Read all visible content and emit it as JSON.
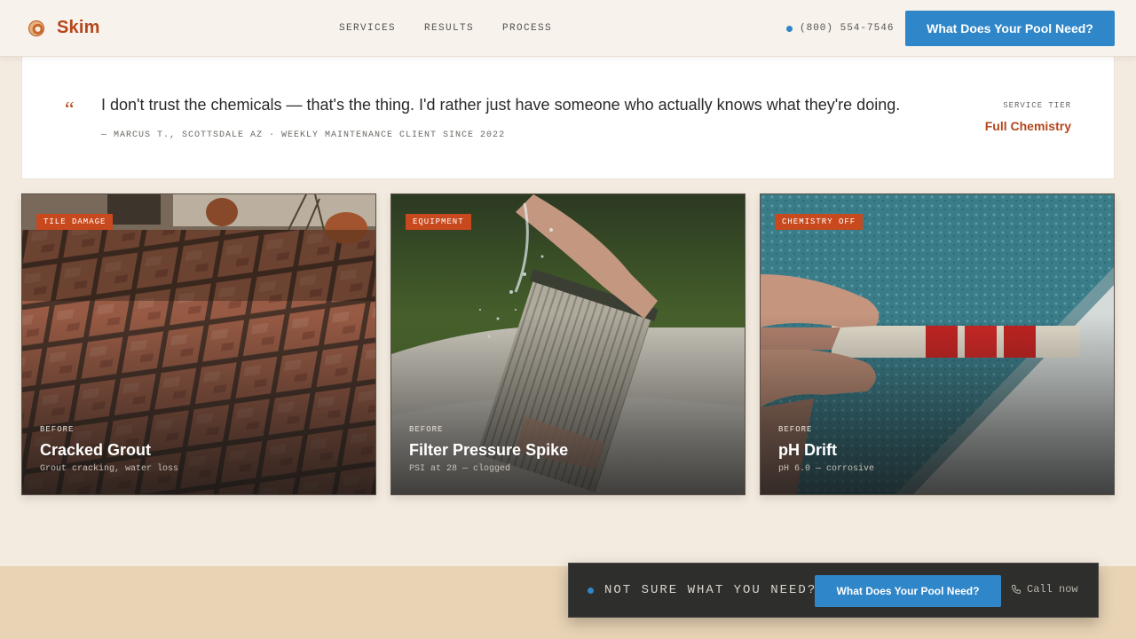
{
  "header": {
    "logo_text": "Skim",
    "nav": [
      "SERVICES",
      "RESULTS",
      "PROCESS"
    ],
    "phone": "(800) 554-7546",
    "cta_label": "What Does Your Pool Need?"
  },
  "testimonial": {
    "quote_mark": "“",
    "quote": "I don't trust the chemicals — that's the thing. I'd rather just have someone who actually knows what they're doing.",
    "attribution": "— MARCUS T., SCOTTSDALE AZ · WEEKLY MAINTENANCE CLIENT SINCE 2022",
    "tier_label": "SERVICE TIER",
    "tier_value": "Full Chemistry"
  },
  "cards": [
    {
      "badge": "TILE DAMAGE",
      "meta": "BEFORE",
      "title": "Cracked Grout",
      "subtitle": "Grout cracking, water loss"
    },
    {
      "badge": "EQUIPMENT",
      "meta": "BEFORE",
      "title": "Filter Pressure Spike",
      "subtitle": "PSI at 28 — clogged"
    },
    {
      "badge": "CHEMISTRY OFF",
      "meta": "BEFORE",
      "title": "pH Drift",
      "subtitle": "pH 6.0 — corrosive"
    }
  ],
  "sticky_bar": {
    "text": "NOT SURE WHAT YOU NEED?",
    "cta_label": "What Does Your Pool Need?",
    "call_label": "Call now"
  },
  "colors": {
    "accent_blue": "#2f86c8",
    "brand_rust": "#b5461c",
    "badge_orange": "#c8491d",
    "background_cream": "#f3ebdf"
  },
  "icons": [
    "logo-icon",
    "quote-icon",
    "status-dot-icon",
    "phone-icon"
  ]
}
